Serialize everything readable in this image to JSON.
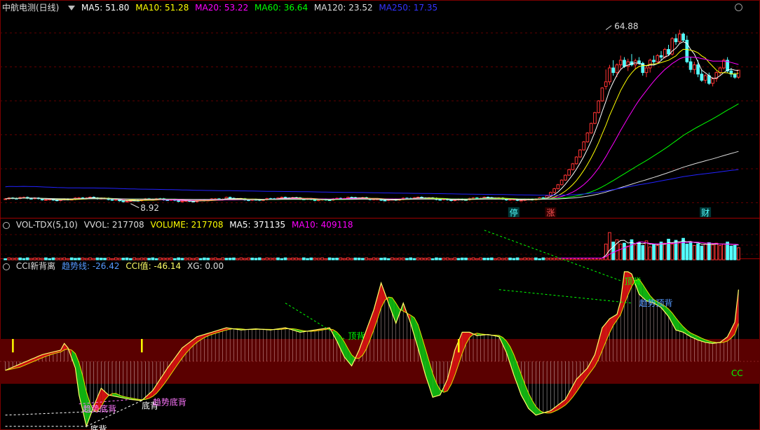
{
  "main_panel": {
    "title": "中航电测(日线)",
    "ma_labels": [
      {
        "text": "MA5: 51.80",
        "color": "#ffffff"
      },
      {
        "text": "MA10: 51.28",
        "color": "#ffff00"
      },
      {
        "text": "MA20: 53.22",
        "color": "#ff00ff"
      },
      {
        "text": "MA60: 36.64",
        "color": "#00ff00"
      },
      {
        "text": "MA120: 23.52",
        "color": "#dddddd"
      },
      {
        "text": "MA250: 17.35",
        "color": "#0000ff"
      }
    ],
    "high_label": "64.88",
    "low_label": "8.92",
    "markers": [
      "停",
      "涨",
      "财"
    ]
  },
  "volume_panel": {
    "title": "VOL-TDX(5,10)",
    "labels": [
      {
        "text": "VVOL: 217708",
        "color": "#dddddd"
      },
      {
        "text": "VOLUME: 217708",
        "color": "#ffff00"
      },
      {
        "text": "MA5: 371135",
        "color": "#ffffff"
      },
      {
        "text": "MA10: 409118",
        "color": "#ff00ff"
      }
    ]
  },
  "cci_panel": {
    "title": "CCI新背离",
    "labels": [
      {
        "text": "趋势线: -26.42",
        "color": "#5599ff"
      },
      {
        "text": "CCI值: -46.14",
        "color": "#ffff66"
      },
      {
        "text": "XG: 0.00",
        "color": "#dddddd"
      }
    ],
    "annotations": [
      {
        "text": "底背",
        "color": "#ffffff"
      },
      {
        "text": "趋势底背",
        "color": "#ff77ff"
      },
      {
        "text": "底背",
        "color": "#ffffff"
      },
      {
        "text": "趋势底背",
        "color": "#ff77ff"
      },
      {
        "text": "顶背",
        "color": "#00ff00"
      },
      {
        "text": "顶背",
        "color": "#00ff00"
      },
      {
        "text": "趋势顶背",
        "color": "#5599ff"
      },
      {
        "text": "CC",
        "color": "#00ff00"
      }
    ]
  },
  "chart_data": {
    "type": "candlestick",
    "days": 200,
    "price_range": [
      5,
      70
    ],
    "price_max": 64.88,
    "price_min": 8.92,
    "pre_rally_price": 10.0,
    "rally_closes": [
      11.0,
      12.1,
      13.3,
      14.6,
      16.1,
      17.7,
      19.5,
      21.4,
      23.6,
      25.9,
      28.5,
      31.4,
      34.5,
      38.0,
      41.8,
      46.0
    ],
    "late_ohlc": [
      [
        46.5,
        52.0,
        45.5,
        48.0
      ],
      [
        48.0,
        53.5,
        47.0,
        52.5
      ],
      [
        52.5,
        55.0,
        50.0,
        51.0
      ],
      [
        51.0,
        54.0,
        49.5,
        53.5
      ],
      [
        53.5,
        56.5,
        52.0,
        55.0
      ],
      [
        55.0,
        56.0,
        52.5,
        53.0
      ],
      [
        53.0,
        55.5,
        51.5,
        54.5
      ],
      [
        54.5,
        57.0,
        53.0,
        53.5
      ],
      [
        53.5,
        55.5,
        52.0,
        54.8
      ],
      [
        54.8,
        56.0,
        53.5,
        54.0
      ],
      [
        54.0,
        54.5,
        50.0,
        51.0
      ],
      [
        51.0,
        53.0,
        49.5,
        52.5
      ],
      [
        52.5,
        55.5,
        51.0,
        55.0
      ],
      [
        55.0,
        56.5,
        53.5,
        54.5
      ],
      [
        54.5,
        57.0,
        54.0,
        56.5
      ],
      [
        56.5,
        58.0,
        55.0,
        56.0
      ],
      [
        56.0,
        59.0,
        55.5,
        58.5
      ],
      [
        58.5,
        60.0,
        56.5,
        57.0
      ],
      [
        57.0,
        62.5,
        56.5,
        62.0
      ],
      [
        62.0,
        63.5,
        60.0,
        61.0
      ],
      [
        61.0,
        64.88,
        60.5,
        63.5
      ],
      [
        63.5,
        64.0,
        61.0,
        61.5
      ],
      [
        61.5,
        63.0,
        54.0,
        54.5
      ],
      [
        54.5,
        56.0,
        51.0,
        52.0
      ],
      [
        52.0,
        54.5,
        50.5,
        53.5
      ],
      [
        53.5,
        55.0,
        49.5,
        50.5
      ],
      [
        50.5,
        52.0,
        48.0,
        48.5
      ],
      [
        48.5,
        50.5,
        47.5,
        50.0
      ],
      [
        50.0,
        51.0,
        47.0,
        47.5
      ],
      [
        47.5,
        49.5,
        46.5,
        49.0
      ],
      [
        49.0,
        51.5,
        48.0,
        51.0
      ],
      [
        51.0,
        53.0,
        50.0,
        52.5
      ],
      [
        52.5,
        55.5,
        52.0,
        55.0
      ],
      [
        55.0,
        56.0,
        51.0,
        51.5
      ],
      [
        51.5,
        52.5,
        49.5,
        50.5
      ],
      [
        50.5,
        51.0,
        49.0,
        49.5
      ],
      [
        49.5,
        51.5,
        49.0,
        51.8
      ]
    ],
    "volume_spikes": [
      0.55,
      0.95,
      0.62,
      0.7,
      0.55,
      0.58,
      0.48,
      0.7,
      0.52,
      0.6,
      0.5,
      0.66,
      0.45,
      0.55,
      0.5,
      0.62,
      0.58,
      0.72,
      0.55,
      0.68,
      0.6,
      0.75,
      0.55,
      0.62,
      0.5,
      0.56,
      0.48,
      0.55,
      0.6,
      0.52,
      0.58,
      0.5,
      0.55,
      0.62,
      0.48,
      0.5,
      0.42
    ],
    "cci_range": [
      -300,
      400
    ],
    "cci_band": [
      -100,
      100
    ],
    "cci_keypoints": [
      [
        0,
        -40
      ],
      [
        5,
        -5
      ],
      [
        10,
        30
      ],
      [
        15,
        50
      ],
      [
        16,
        80
      ],
      [
        17,
        60
      ],
      [
        19,
        -30
      ],
      [
        20,
        -150
      ],
      [
        22,
        -290
      ],
      [
        24,
        -200
      ],
      [
        26,
        -120
      ],
      [
        28,
        -150
      ],
      [
        31,
        -160
      ],
      [
        34,
        -170
      ],
      [
        37,
        -175
      ],
      [
        40,
        -130
      ],
      [
        44,
        -30
      ],
      [
        48,
        60
      ],
      [
        52,
        110
      ],
      [
        56,
        130
      ],
      [
        60,
        150
      ],
      [
        64,
        140
      ],
      [
        68,
        145
      ],
      [
        72,
        140
      ],
      [
        76,
        150
      ],
      [
        80,
        130
      ],
      [
        84,
        140
      ],
      [
        88,
        150
      ],
      [
        90,
        90
      ],
      [
        92,
        20
      ],
      [
        94,
        -20
      ],
      [
        96,
        50
      ],
      [
        100,
        230
      ],
      [
        102,
        350
      ],
      [
        104,
        260
      ],
      [
        106,
        170
      ],
      [
        108,
        260
      ],
      [
        110,
        170
      ],
      [
        112,
        60
      ],
      [
        114,
        -60
      ],
      [
        116,
        -160
      ],
      [
        118,
        -150
      ],
      [
        120,
        -80
      ],
      [
        122,
        50
      ],
      [
        124,
        130
      ],
      [
        126,
        130
      ],
      [
        128,
        115
      ],
      [
        131,
        120
      ],
      [
        134,
        110
      ],
      [
        136,
        40
      ],
      [
        138,
        -60
      ],
      [
        140,
        -150
      ],
      [
        142,
        -210
      ],
      [
        144,
        -240
      ],
      [
        146,
        -230
      ],
      [
        148,
        -220
      ],
      [
        152,
        -170
      ],
      [
        155,
        -80
      ],
      [
        158,
        -30
      ],
      [
        160,
        30
      ],
      [
        162,
        150
      ],
      [
        164,
        190
      ],
      [
        166,
        210
      ],
      [
        167,
        270
      ],
      [
        168,
        585
      ],
      [
        170,
        390
      ],
      [
        172,
        300
      ],
      [
        174,
        270
      ],
      [
        176,
        260
      ],
      [
        178,
        240
      ],
      [
        180,
        200
      ],
      [
        182,
        140
      ],
      [
        184,
        130
      ],
      [
        186,
        110
      ],
      [
        188,
        95
      ],
      [
        190,
        85
      ],
      [
        192,
        80
      ],
      [
        194,
        85
      ],
      [
        196,
        110
      ],
      [
        198,
        175
      ],
      [
        199,
        320
      ],
      [
        200,
        300
      ]
    ]
  }
}
